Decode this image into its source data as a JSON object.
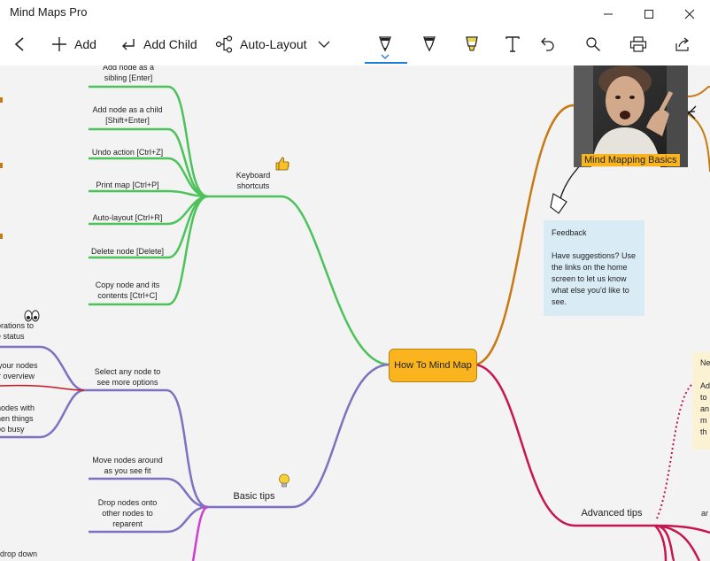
{
  "window": {
    "title": "Mind Maps Pro",
    "min_icon": "minimize-icon",
    "max_icon": "maximize-icon",
    "close_icon": "close-icon"
  },
  "toolbar": {
    "back_icon": "back-arrow-icon",
    "add_label": "Add",
    "add_child_label": "Add Child",
    "autolayout_label": "Auto-Layout",
    "tools": [
      "pen-icon",
      "marker-icon",
      "highlighter-icon",
      "text-icon",
      "undo-icon",
      "search-icon",
      "print-icon",
      "share-icon"
    ],
    "accent": "#1e7dd6"
  },
  "map": {
    "root": "How To Mind Map",
    "keyboard": {
      "title": "Keyboard\nshortcuts",
      "items": [
        "Add node as a\nsibling [Enter]",
        "Add node as a child\n[Shift+Enter]",
        "Undo action [Ctrl+Z]",
        "Print map [Ctrl+P]",
        "Auto-layout [Ctrl+R]",
        "Delete node [Delete]",
        "Copy node and its\ncontents [Ctrl+C]"
      ],
      "color": "#4cc25a",
      "icon": "thumbs-up-icon"
    },
    "basic": {
      "title": "Basic tips",
      "items": [
        "Select any node to\nsee more options",
        "Move nodes around\nas you see fit",
        "Drop nodes onto\nother nodes to\nreparent"
      ],
      "color": "#7f70c0",
      "icon": "lightbulb-icon"
    },
    "left_fragments": [
      "orations to\ne status",
      "your nodes\nr overview",
      "nodes with\nhen things\noo busy",
      "drop down"
    ],
    "eyes_icon": "eyes-icon",
    "advanced": {
      "title": "Advanced tips",
      "color": "#c7164f",
      "fragment": "ar"
    },
    "basics_label": "Mind Mapping Basics",
    "orange": "#c77a12",
    "feedback": {
      "title": "Feedback",
      "body": "Have suggestions? Use the links on the home screen to let us know what else you'd like to see."
    },
    "note": {
      "lines": [
        "Ne",
        "",
        "Ad",
        "to",
        "an",
        "m",
        "th"
      ]
    }
  }
}
